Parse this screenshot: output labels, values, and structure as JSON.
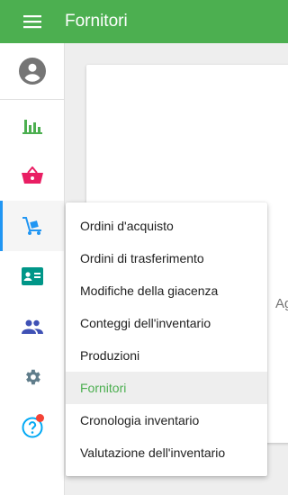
{
  "appbar": {
    "title": "Fornitori",
    "color": "#4caf50"
  },
  "sidebar": {
    "items": [
      {
        "icon": "account-circle-icon",
        "color": "#757575"
      },
      {
        "icon": "bar-chart-icon",
        "color": "#4caf50"
      },
      {
        "icon": "basket-icon",
        "color": "#e91e63"
      },
      {
        "icon": "inventory-dolly-icon",
        "color": "#2196f3",
        "active": true
      },
      {
        "icon": "id-card-icon",
        "color": "#009688"
      },
      {
        "icon": "people-icon",
        "color": "#3f51b5"
      },
      {
        "icon": "settings-gear-icon",
        "color": "#607d8b"
      },
      {
        "icon": "help-icon",
        "color": "#03a9f4",
        "badge": true
      }
    ]
  },
  "content": {
    "partial_text": "Ag"
  },
  "menu": {
    "items": [
      {
        "label": "Ordini d'acquisto"
      },
      {
        "label": "Ordini di trasferimento"
      },
      {
        "label": "Modifiche della giacenza"
      },
      {
        "label": "Conteggi dell'inventario"
      },
      {
        "label": "Produzioni"
      },
      {
        "label": "Fornitori",
        "selected": true
      },
      {
        "label": "Cronologia inventario"
      },
      {
        "label": "Valutazione dell'inventario"
      }
    ],
    "selected_color": "#4caf50"
  }
}
